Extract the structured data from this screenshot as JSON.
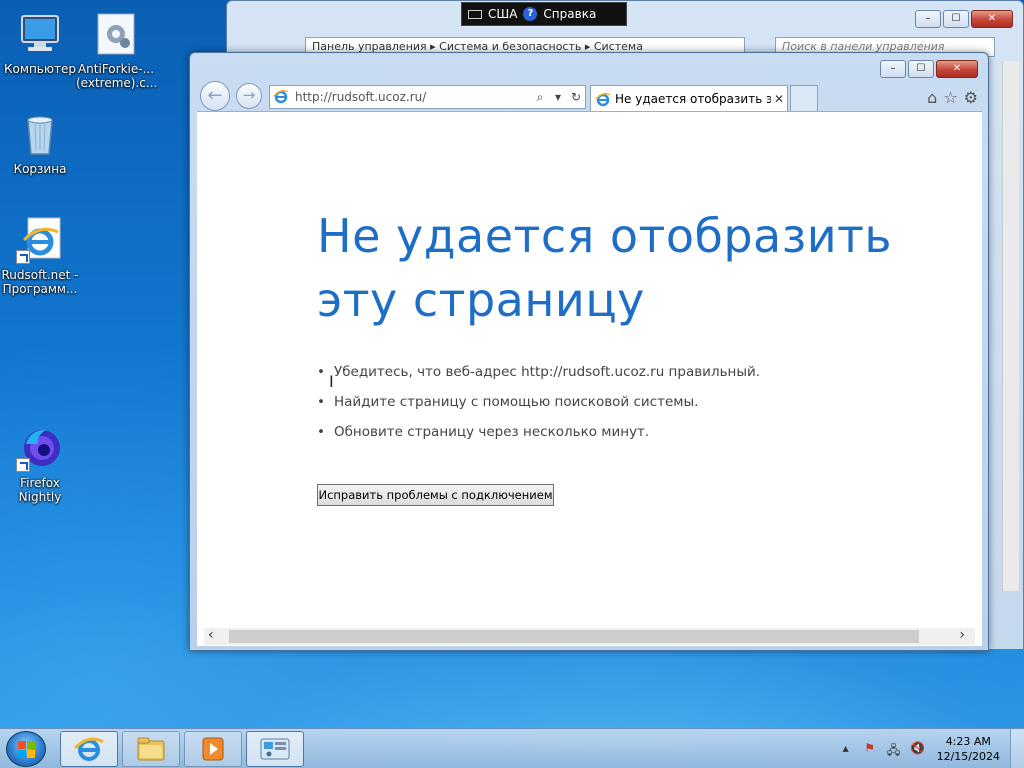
{
  "language_bar": {
    "lang": "США",
    "help": "Справка"
  },
  "desktop_icons": [
    {
      "label": "Компьютер"
    },
    {
      "label": "AntiForkie-... (extreme).c..."
    },
    {
      "label": "Корзина"
    },
    {
      "label": "Rudsoft.net - Программ..."
    },
    {
      "label": "Firefox Nightly"
    }
  ],
  "control_panel": {
    "breadcrumb": "Панель управления  ▸  Система и безопасность  ▸  Система",
    "search_placeholder": "Поиск в панели управления",
    "window_buttons": [
      "–",
      "☐",
      "✕"
    ]
  },
  "ie": {
    "address_url": "http://rudsoft.ucoz.ru/",
    "tab_title": "Не удается отобразить эту...",
    "tab_close": "✕",
    "window_buttons": [
      "–",
      "☐",
      "✕"
    ],
    "error": {
      "title": "Не удается отобразить эту страницу",
      "bullets": [
        "Убедитесь, что веб-адрес http://rudsoft.ucoz.ru правильный.",
        "Найдите страницу с помощью поисковой системы.",
        "Обновите страницу через несколько минут."
      ],
      "fix_button": "Исправить проблемы с подключением"
    }
  },
  "taskbar": {
    "apps": [
      "Internet Explorer",
      "Explorer",
      "Media Player",
      "Control Panel"
    ],
    "clock_time": "4:23 AM",
    "clock_date": "12/15/2024"
  }
}
